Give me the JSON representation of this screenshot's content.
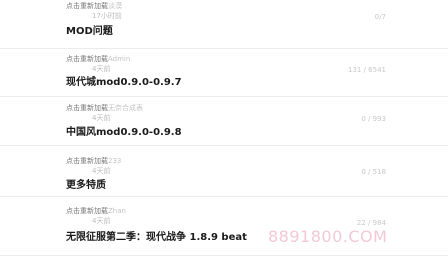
{
  "posts": [
    {
      "reload": "点击重新加载",
      "author": "淡漠",
      "time": "17小时前",
      "stats": "0/7",
      "title": "MOD问题"
    },
    {
      "reload": "点击重新加载",
      "author": "Admin",
      "time": "4天前",
      "stats": "131 / 6541",
      "title": "现代城mod0.9.0-0.9.7"
    },
    {
      "reload": "点击重新加载",
      "author": "无奈合成表",
      "time": "4天前",
      "stats": "0 / 993",
      "title": "中国风mod0.9.0-0.9.8"
    },
    {
      "reload": "点击重新加载",
      "author": "233",
      "time": "4天前",
      "stats": "0 / 518",
      "title": "更多特质"
    },
    {
      "reload": "点击重新加载",
      "author": "Zhan",
      "time": "4天前",
      "stats": "22 / 984",
      "title": "无限征服第二季：现代战争 1.8.9 beat"
    }
  ],
  "watermark": "8891800.COM"
}
